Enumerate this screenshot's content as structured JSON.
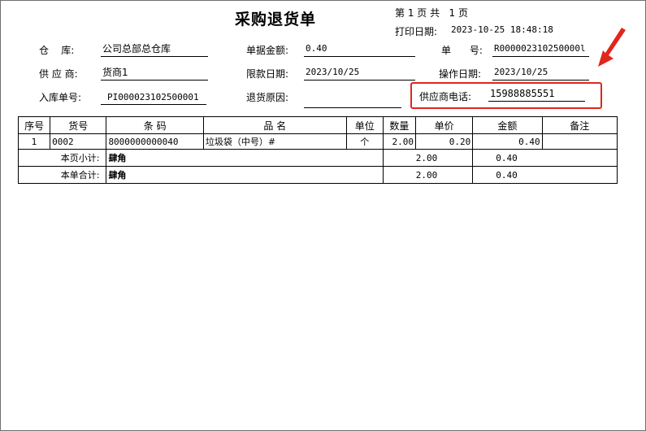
{
  "document": {
    "title": "采购退货单",
    "page_info": "第 1 页 共   1 页",
    "print_date_label": "打印日期:",
    "print_date": "2023-10-25 18:48:18"
  },
  "fields": {
    "warehouse_label": "仓    库:",
    "warehouse": "公司总部总仓库",
    "amount_label": "单据金额:",
    "amount": "0.40",
    "doc_no_label": "单      号:",
    "doc_no": "R000002310250000l",
    "supplier_label": "供 应 商:",
    "supplier": "货商1",
    "due_date_label": "限款日期:",
    "due_date": "2023/10/25",
    "op_date_label": "操作日期:",
    "op_date": "2023/10/25",
    "stock_in_no_label": "入库单号:",
    "stock_in_no": "PI000023102500001",
    "reason_label": "退货原因:",
    "reason": "",
    "supplier_phone_label": "供应商电话:",
    "supplier_phone": "15988885551"
  },
  "table": {
    "headers": [
      "序号",
      "货号",
      "条 码",
      "品 名",
      "单位",
      "数量",
      "单价",
      "金额",
      "备注"
    ],
    "rows": [
      {
        "seq": "1",
        "item_no": "0002",
        "barcode": "8000000000040",
        "name": "垃圾袋（中号）#",
        "unit": "个",
        "qty": "2.00",
        "price": "0.20",
        "amount": "0.40",
        "remark": ""
      }
    ],
    "page_subtotal": {
      "label": "本页小计:",
      "words": "肆角",
      "qty": "2.00",
      "amount": "0.40"
    },
    "doc_total": {
      "label": "本单合计:",
      "words": "肆角",
      "qty": "2.00",
      "amount": "0.40"
    }
  },
  "colors": {
    "highlight": "#e1261c"
  }
}
